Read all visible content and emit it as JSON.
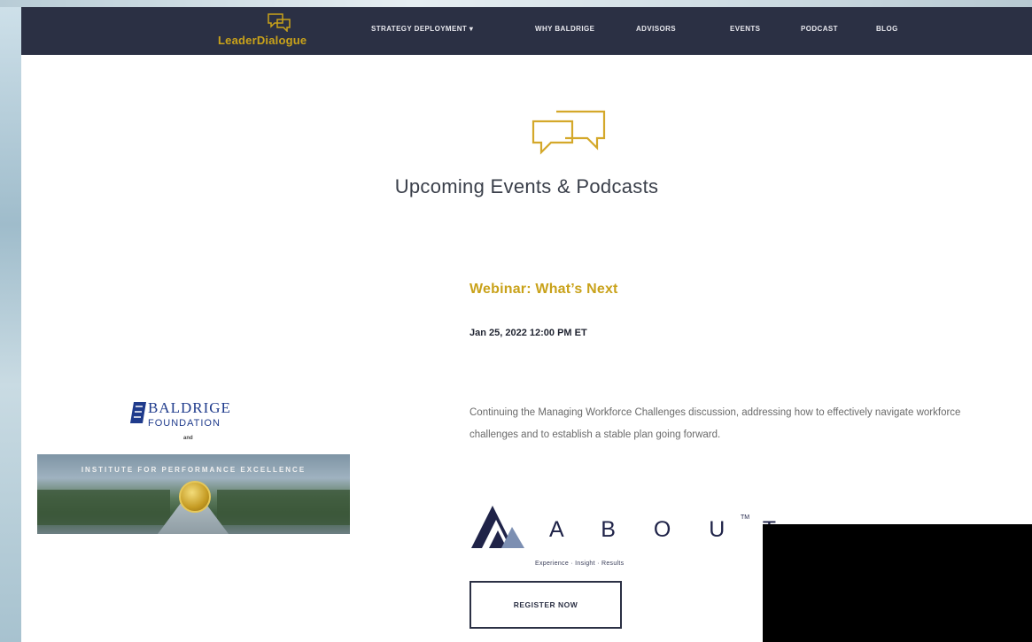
{
  "nav": {
    "logo": "LeaderDialogue",
    "items": [
      "STRATEGY DEPLOYMENT ▾",
      "WHY BALDRIGE",
      "ADVISORS",
      "EVENTS",
      "PODCAST",
      "BLOG"
    ]
  },
  "hero": {
    "heading": "Upcoming Events & Podcasts"
  },
  "event": {
    "title": "Webinar: What’s Next",
    "date": "Jan 25, 2022 12:00 PM ET",
    "description": "Continuing the Managing Workforce Challenges discussion, addressing how to effectively navigate workforce challenges and to establish a stable plan going forward.",
    "sponsor_logo": "A B O U T",
    "sponsor_tm": "TM",
    "sponsor_tagline": "Experience · Insight · Results",
    "register_label": "REGISTER NOW"
  },
  "card": {
    "name": "BALDRIGE",
    "foundation": "FOUNDATION",
    "and": "and",
    "banner_text": "INSTITUTE FOR PERFORMANCE EXCELLENCE"
  },
  "colors": {
    "nav_bg": "#2b3044",
    "accent_gold": "#c9a21a",
    "heading_text": "#3a3f4a"
  }
}
